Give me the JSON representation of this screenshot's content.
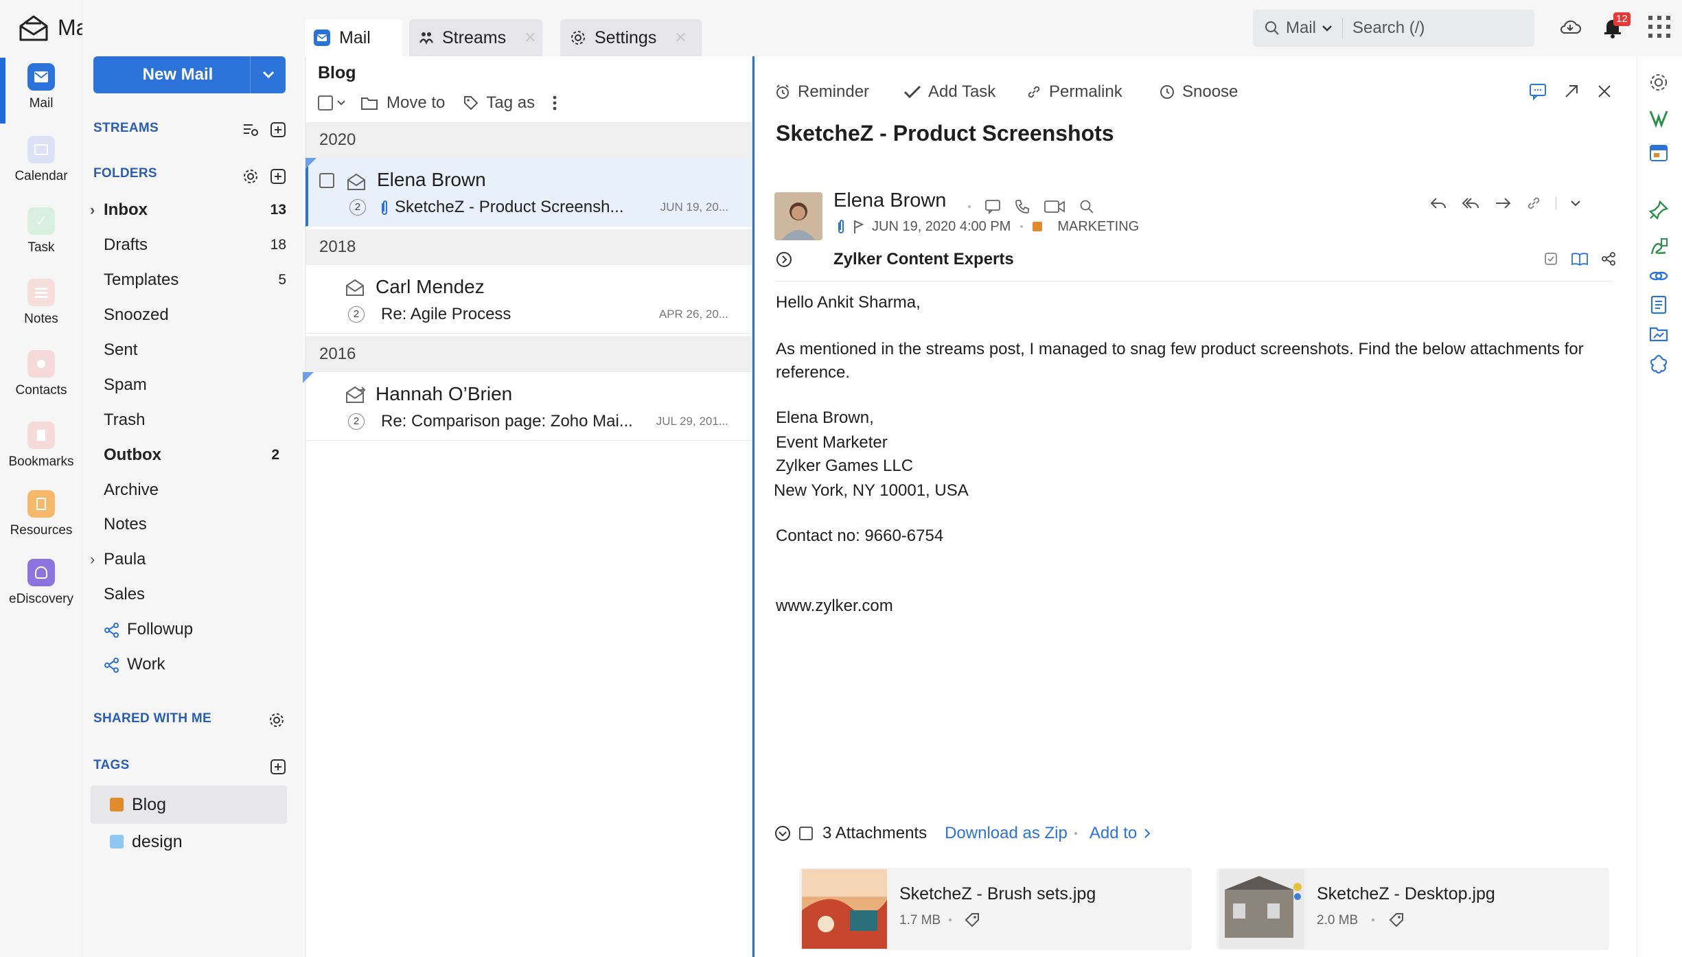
{
  "app": {
    "title": "Mail"
  },
  "rail": {
    "items": [
      {
        "label": "Mail",
        "icon": "mail-icon",
        "color": "#2b72d9"
      },
      {
        "label": "Calendar",
        "icon": "calendar-icon",
        "color": "#d7dcf3"
      },
      {
        "label": "Task",
        "icon": "task-icon",
        "color": "#d6eddc"
      },
      {
        "label": "Notes",
        "icon": "notes-icon",
        "color": "#f4d9d7"
      },
      {
        "label": "Contacts",
        "icon": "contacts-icon",
        "color": "#f3d6d6"
      },
      {
        "label": "Bookmarks",
        "icon": "bookmarks-icon",
        "color": "#f3d6d6"
      },
      {
        "label": "Resources",
        "icon": "resources-icon",
        "color": "#f6b96a"
      },
      {
        "label": "eDiscovery",
        "icon": "ediscovery-icon",
        "color": "#8b74e0"
      }
    ]
  },
  "compose": {
    "label": "New Mail"
  },
  "sections": {
    "streams": "STREAMS",
    "folders": "FOLDERS",
    "shared": "SHARED WITH ME",
    "tags": "TAGS"
  },
  "folders": [
    {
      "name": "Inbox",
      "count": "13",
      "bold": true,
      "expandable": true
    },
    {
      "name": "Drafts",
      "count": "18"
    },
    {
      "name": "Templates",
      "count": "5"
    },
    {
      "name": "Snoozed",
      "count": ""
    },
    {
      "name": "Sent",
      "count": ""
    },
    {
      "name": "Spam",
      "count": ""
    },
    {
      "name": "Trash",
      "count": ""
    },
    {
      "name": "Outbox",
      "count": "2",
      "bold": true
    },
    {
      "name": "Archive",
      "count": ""
    },
    {
      "name": "Notes",
      "count": ""
    },
    {
      "name": "Paula",
      "count": "",
      "expandable": true
    },
    {
      "name": "Sales",
      "count": ""
    },
    {
      "name": "Followup",
      "count": "",
      "shared": true
    },
    {
      "name": "Work",
      "count": "",
      "shared": true
    }
  ],
  "tags": [
    {
      "name": "Blog",
      "color": "#e08a2c"
    },
    {
      "name": "design",
      "color": "#8ec7f2"
    }
  ],
  "tabs": [
    {
      "label": "Mail",
      "icon": "mail-icon"
    },
    {
      "label": "Streams",
      "icon": "streams-icon"
    },
    {
      "label": "Settings",
      "icon": "gear-icon"
    }
  ],
  "search": {
    "scope": "Mail",
    "placeholder": "Search (/)"
  },
  "notifications": {
    "count": "12"
  },
  "list": {
    "title": "Blog",
    "tools": {
      "move": "Move to",
      "tag": "Tag as"
    },
    "groups": [
      {
        "year": "2020",
        "mails": [
          {
            "from": "Elena Brown",
            "subject": "SketcheZ - Product Screensh...",
            "date": "JUN 19, 20...",
            "count": "2",
            "attachment": true,
            "selected": true
          }
        ]
      },
      {
        "year": "2018",
        "mails": [
          {
            "from": "Carl Mendez",
            "subject": "Re: Agile Process",
            "date": "APR 26, 20...",
            "count": "2"
          }
        ]
      },
      {
        "year": "2016",
        "mails": [
          {
            "from": "Hannah O’Brien",
            "subject": "Re: Comparison page: Zoho Mai...",
            "date": "JUL 29, 201...",
            "count": "2"
          }
        ]
      }
    ]
  },
  "reader": {
    "actions": {
      "reminder": "Reminder",
      "task": "Add Task",
      "permalink": "Permalink",
      "snooze": "Snoose"
    },
    "subject": "SketcheZ - Product Screenshots",
    "sender": "Elena Brown",
    "datetime": "JUN 19, 2020 4:00 PM",
    "label": "MARKETING",
    "stream": "Zylker Content Experts",
    "body": {
      "greeting": "Hello  Ankit Sharma,",
      "message": "As mentioned in the streams post, I managed to snag few product screenshots. Find the below attachments for reference.",
      "sig1": "Elena Brown,",
      "sig2": "Event Marketer",
      "sig3": "Zylker Games LLC",
      "sig4": "New York, NY 10001, USA",
      "contact": "Contact no: 9660-6754",
      "web": "www.zylker.com"
    },
    "attachments": {
      "summary": "3 Attachments",
      "download": "Download as Zip",
      "addto": "Add to",
      "files": [
        {
          "name": "SketcheZ - Brush sets.jpg",
          "size": "1.7 MB"
        },
        {
          "name": "SketcheZ - Desktop.jpg",
          "size": "2.0 MB"
        }
      ]
    }
  },
  "colors": {
    "accent": "#2b72d9",
    "badge": "#e53935"
  }
}
